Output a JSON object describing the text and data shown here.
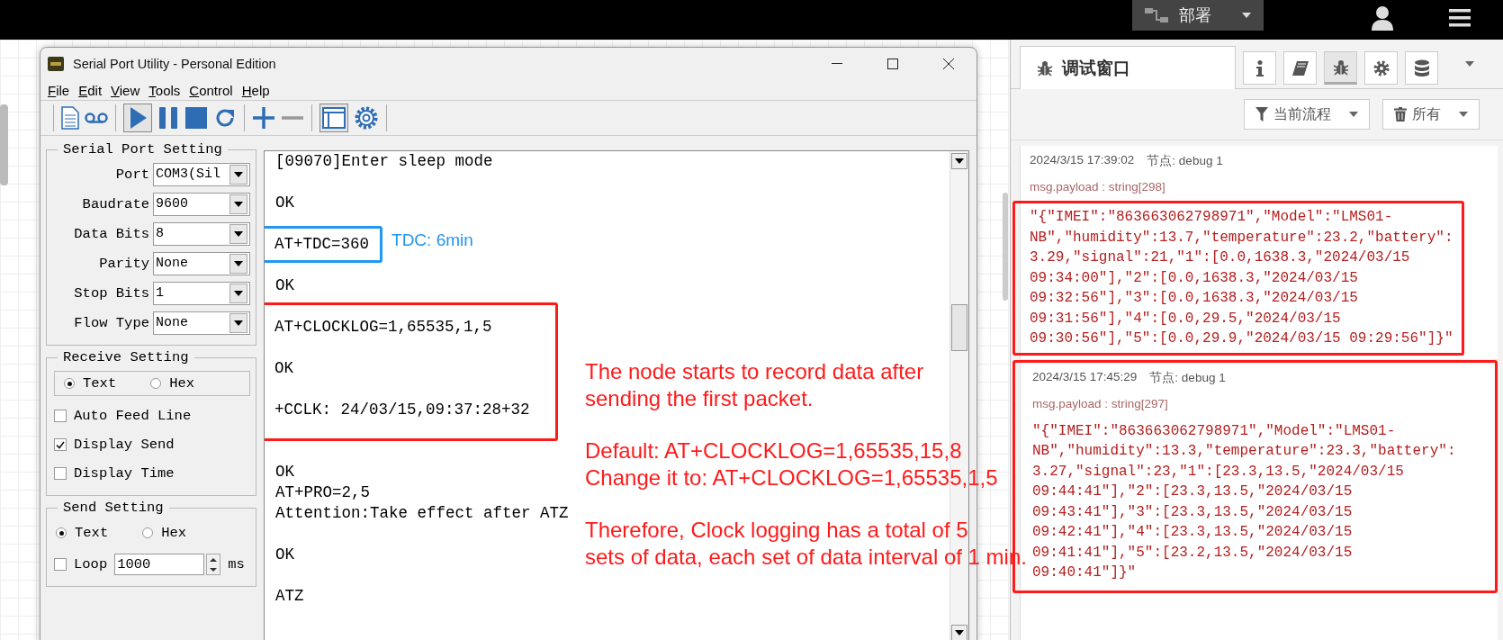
{
  "top_bar": {
    "deploy": {
      "label": "部署"
    }
  },
  "serial_window": {
    "title": "Serial Port Utility - Personal Edition",
    "menu": [
      "File",
      "Edit",
      "View",
      "Tools",
      "Control",
      "Help"
    ],
    "serial_port_setting": {
      "title": "Serial Port Setting",
      "fields": [
        {
          "label": "Port",
          "value": "COM3(Sil"
        },
        {
          "label": "Baudrate",
          "value": "9600"
        },
        {
          "label": "Data Bits",
          "value": "8"
        },
        {
          "label": "Parity",
          "value": "None"
        },
        {
          "label": "Stop Bits",
          "value": "1"
        },
        {
          "label": "Flow Type",
          "value": "None"
        }
      ]
    },
    "receive_setting": {
      "title": "Receive Setting",
      "modes": [
        {
          "label": "Text",
          "selected": true
        },
        {
          "label": "Hex",
          "selected": false
        }
      ],
      "options": [
        {
          "label": "Auto Feed Line",
          "checked": false
        },
        {
          "label": "Display Send",
          "checked": true
        },
        {
          "label": "Display Time",
          "checked": false
        }
      ]
    },
    "send_setting": {
      "title": "Send Setting",
      "modes": [
        {
          "label": "Text",
          "selected": true
        },
        {
          "label": "Hex",
          "selected": false
        }
      ],
      "loop": {
        "label": "Loop",
        "checked": false,
        "value": "1000",
        "unit": "ms"
      }
    },
    "terminal": {
      "blocks": [
        {
          "lines": [
            "[09070]Enter sleep mode"
          ]
        },
        {
          "lines": [
            "OK"
          ]
        },
        {
          "lines": [
            "AT+TDC=360"
          ],
          "color": "#2196f3",
          "note": "TDC: 6min"
        },
        {
          "lines": [
            "OK"
          ]
        },
        {
          "lines": [
            "AT+CLOCKLOG=1,65535,1,5",
            "OK",
            "+CCLK: 24/03/15,09:37:28+32"
          ],
          "color": "#ff1a1a"
        },
        {
          "lines": [
            "OK",
            "AT+PRO=2,5",
            "Attention:Take effect after ATZ"
          ]
        },
        {
          "lines": [
            "OK"
          ]
        },
        {
          "lines": [
            "ATZ"
          ]
        }
      ]
    }
  },
  "annotation_notes": [
    [
      "The node starts to record data after\nsending the first packet."
    ],
    [
      "Default: AT+CLOCKLOG=1,65535,15,8",
      "Change it to: AT+CLOCKLOG=1,65535,1,5"
    ],
    [
      "Therefore, Clock logging has a total of 5\nsets of data, each set of data interval of 1 min."
    ]
  ],
  "debug_sidebar": {
    "tab": {
      "label": "调试窗口"
    },
    "tool_tabs": [
      {
        "kind": "info",
        "selected": false
      },
      {
        "kind": "book",
        "selected": false
      },
      {
        "kind": "debug",
        "selected": true
      },
      {
        "kind": "settings",
        "selected": false
      },
      {
        "kind": "database",
        "selected": false
      }
    ],
    "filters": [
      {
        "kind": "filter",
        "label": "当前流程"
      },
      {
        "kind": "clear",
        "label": "所有"
      }
    ],
    "messages": [
      {
        "time": "2024/3/15 17:39:02",
        "node": "节点: debug 1",
        "type": "msg.payload : string[298]",
        "kind": "framed_payload",
        "payload": "\"{\"IMEI\":\"863663062798971\",\"Model\":\"LMS01-NB\",\"humidity\":13.7,\"temperature\":23.2,\"battery\":3.29,\"signal\":21,\"1\":[0.0,1638.3,\"2024/03/15 09:34:00\"],\"2\":[0.0,1638.3,\"2024/03/15 09:32:56\"],\"3\":[0.0,1638.3,\"2024/03/15 09:31:56\"],\"4\":[0.0,29.5,\"2024/03/15 09:30:56\"],\"5\":[0.0,29.9,\"2024/03/15 09:29:56\"]}\""
      },
      {
        "time": "2024/3/15 17:45:29",
        "node": "节点: debug 1",
        "type": "msg.payload : string[297]",
        "kind": "framed_message",
        "payload": "\"{\"IMEI\":\"863663062798971\",\"Model\":\"LMS01-NB\",\"humidity\":13.3,\"temperature\":23.3,\"battery\":3.27,\"signal\":23,\"1\":[23.3,13.5,\"2024/03/15 09:44:41\"],\"2\":[23.3,13.5,\"2024/03/15 09:43:41\"],\"3\":[23.3,13.5,\"2024/03/15 09:42:41\"],\"4\":[23.3,13.5,\"2024/03/15 09:41:41\"],\"5\":[23.2,13.5,\"2024/03/15 09:40:41\"]}\""
      }
    ]
  }
}
